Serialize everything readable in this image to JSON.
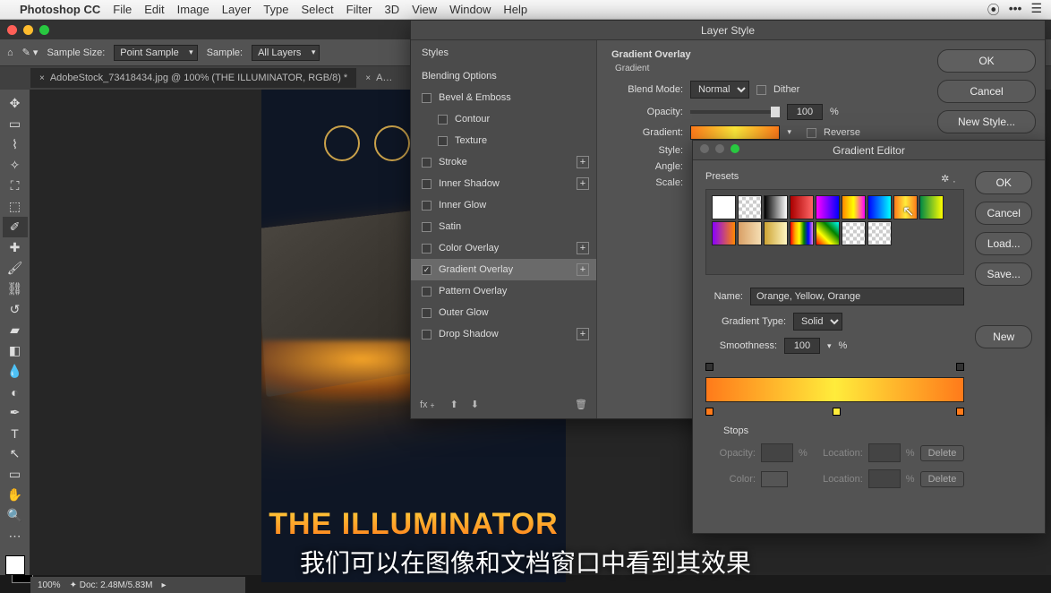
{
  "menu": {
    "app": "Photoshop CC",
    "items": [
      "File",
      "Edit",
      "Image",
      "Layer",
      "Type",
      "Select",
      "Filter",
      "3D",
      "View",
      "Window",
      "Help"
    ]
  },
  "optionsBar": {
    "sampleSizeLabel": "Sample Size:",
    "sampleSizeValue": "Point Sample",
    "sampleLabel": "Sample:",
    "sampleValue": "All Layers"
  },
  "tabs": {
    "active": "AdobeStock_73418434.jpg @ 100% (THE ILLUMINATOR, RGB/8) *",
    "inactive": "A…"
  },
  "statusBar": {
    "zoom": "100%",
    "doc": "Doc: 2.48M/5.83M"
  },
  "artwork": {
    "title": "THE ILLUMINATOR"
  },
  "layerStyle": {
    "title": "Layer Style",
    "stylesHeader": "Styles",
    "blendingOptions": "Blending Options",
    "effects": {
      "bevel": "Bevel & Emboss",
      "contour": "Contour",
      "texture": "Texture",
      "stroke": "Stroke",
      "innerShadow": "Inner Shadow",
      "innerGlow": "Inner Glow",
      "satin": "Satin",
      "colorOverlay": "Color Overlay",
      "gradientOverlay": "Gradient Overlay",
      "patternOverlay": "Pattern Overlay",
      "outerGlow": "Outer Glow",
      "dropShadow": "Drop Shadow"
    },
    "panel": {
      "heading": "Gradient Overlay",
      "sub": "Gradient",
      "blendModeLabel": "Blend Mode:",
      "blendModeValue": "Normal",
      "dither": "Dither",
      "opacityLabel": "Opacity:",
      "opacityValue": "100",
      "pct": "%",
      "gradientLabel": "Gradient:",
      "reverse": "Reverse",
      "styleLabel": "Style:",
      "angleLabel": "Angle:",
      "scaleLabel": "Scale:"
    },
    "buttons": {
      "ok": "OK",
      "cancel": "Cancel",
      "newStyle": "New Style..."
    }
  },
  "gradientEditor": {
    "title": "Gradient Editor",
    "presetsLabel": "Presets",
    "buttons": {
      "ok": "OK",
      "cancel": "Cancel",
      "load": "Load...",
      "save": "Save...",
      "new": "New"
    },
    "nameLabel": "Name:",
    "nameValue": "Orange, Yellow, Orange",
    "typeLabel": "Gradient Type:",
    "typeValue": "Solid",
    "smoothLabel": "Smoothness:",
    "smoothValue": "100",
    "pct": "%",
    "stopsHeader": "Stops",
    "opacityLabel": "Opacity:",
    "locationLabel": "Location:",
    "colorLabel": "Color:",
    "delete": "Delete",
    "presetSwatches": [
      "linear-gradient(#fff,#fff)",
      "repeating-conic-gradient(#ccc 0 25%,#fff 0 50%) 0/8px 8px",
      "linear-gradient(90deg,#000,#fff)",
      "linear-gradient(90deg,#a00,#f66)",
      "linear-gradient(90deg,#f0f,#00f)",
      "linear-gradient(90deg,#f80,#ff0,#f0f)",
      "linear-gradient(90deg,#00f,#0ff)",
      "linear-gradient(90deg,#ff7a1a,#ffec3b,#ff7a1a)",
      "linear-gradient(90deg,#084,#ff0)",
      "linear-gradient(90deg,#80f,#f80)",
      "linear-gradient(90deg,#d9a066,#f5deb3)",
      "linear-gradient(90deg,#cda434,#fff6c2)",
      "linear-gradient(90deg,red,orange,yellow,green,blue,violet)",
      "linear-gradient(45deg,red,yellow,green,cyan)",
      "repeating-conic-gradient(#ccc 0 25%,#fff 0 50%) 0/8px 8px",
      "repeating-conic-gradient(#ccc 0 25%,#fff 0 50%) 0/8px 8px"
    ]
  },
  "subtitle": "我们可以在图像和文档窗口中看到其效果"
}
